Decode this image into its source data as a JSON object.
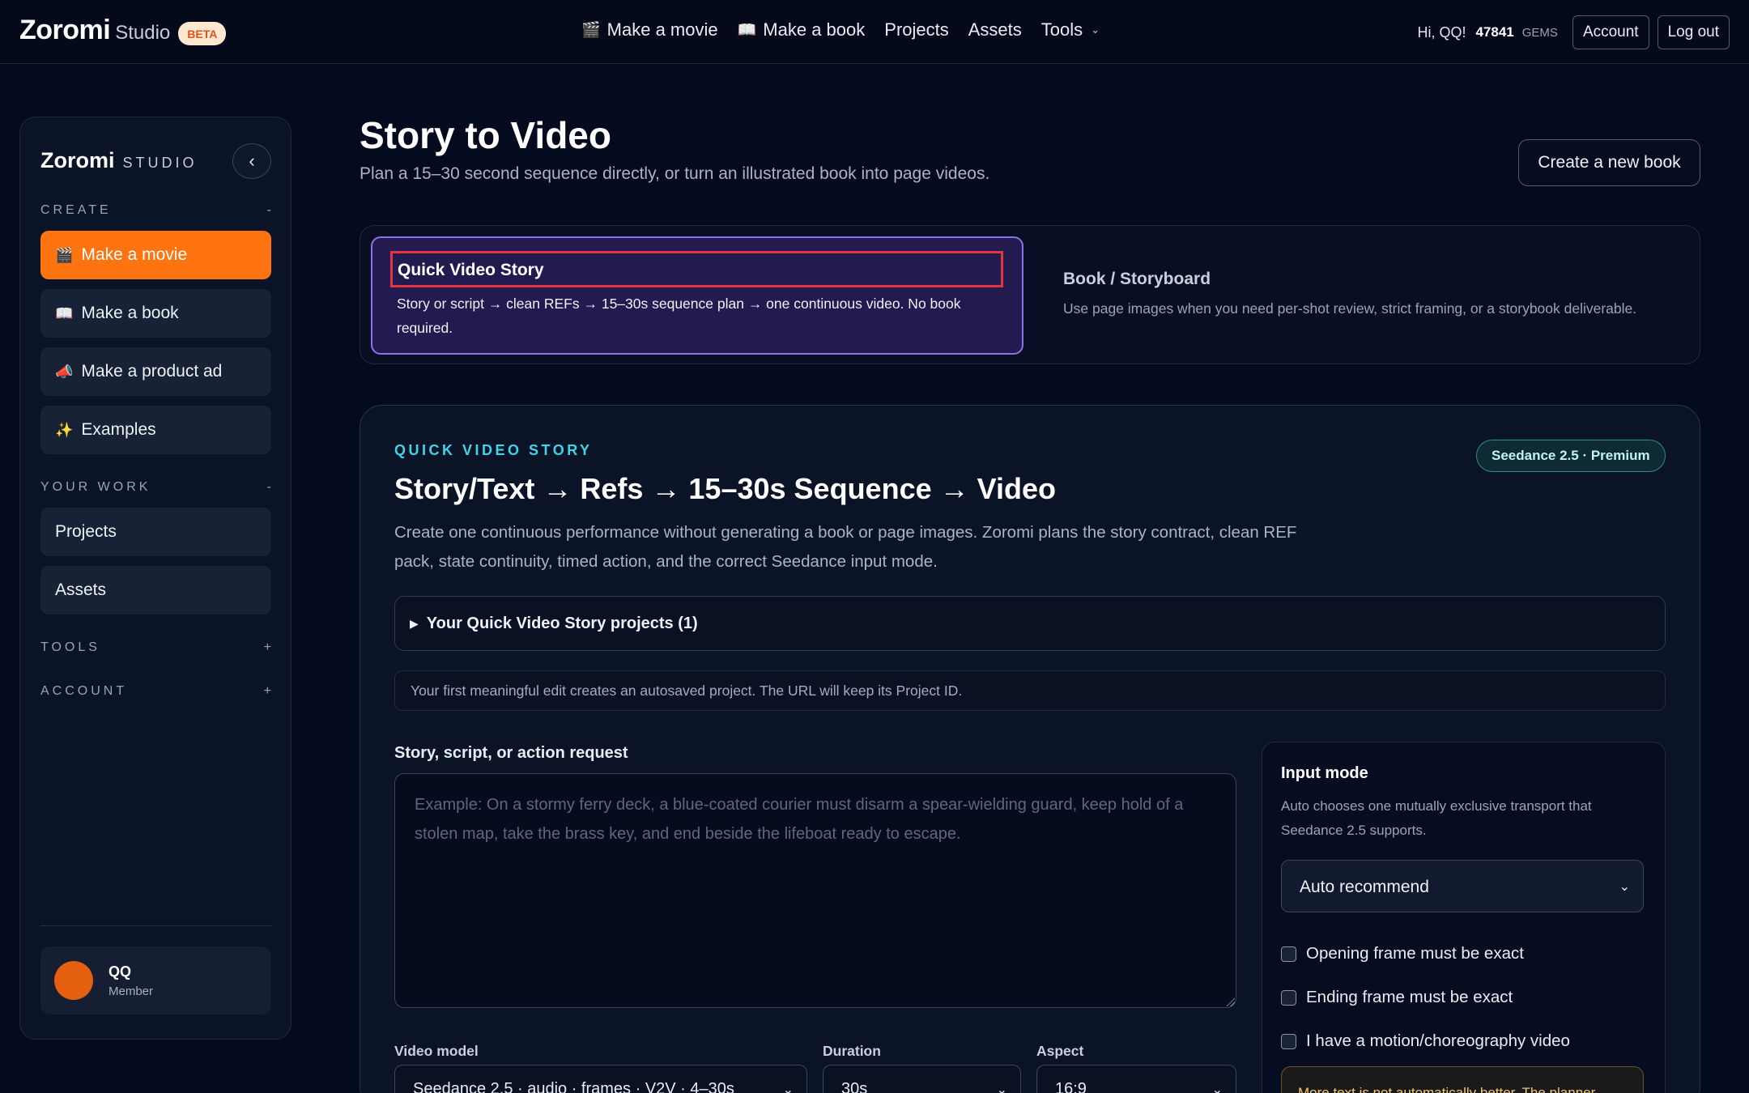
{
  "topbar": {
    "brand": "Zoromi",
    "brand_sub": "Studio",
    "badge": "BETA",
    "nav": [
      {
        "icon": "🎬",
        "label": "Make a movie"
      },
      {
        "icon": "📖",
        "label": "Make a book"
      },
      {
        "icon": "",
        "label": "Projects"
      },
      {
        "icon": "",
        "label": "Assets"
      },
      {
        "icon": "",
        "label": "Tools"
      }
    ],
    "tools_caret": "⌄",
    "greeting": "Hi, QQ!",
    "gems_count": "47841",
    "gems_label": "GEMS",
    "account_label": "Account",
    "logout_label": "Log out"
  },
  "sidebar": {
    "title": "Zoromi",
    "studio": "STUDIO",
    "collapse_icon": "‹",
    "create_label": "CREATE",
    "create_toggle": "-",
    "create_items": [
      {
        "icon": "🎬",
        "label": "Make a movie"
      },
      {
        "icon": "📖",
        "label": "Make a book"
      },
      {
        "icon": "📣",
        "label": "Make a product ad"
      },
      {
        "icon": "✨",
        "label": "Examples"
      }
    ],
    "work_label": "YOUR WORK",
    "work_toggle": "-",
    "work_items": [
      {
        "label": "Projects"
      },
      {
        "label": "Assets"
      }
    ],
    "tools_label": "TOOLS",
    "tools_toggle": "+",
    "account_label": "ACCOUNT",
    "account_toggle": "+",
    "user_name": "QQ",
    "user_role": "Member"
  },
  "main": {
    "title": "Story to Video",
    "subtitle": "Plan a 15–30 second sequence directly, or turn an illustrated book into page videos.",
    "new_book_button": "Create a new book",
    "modes": {
      "active_title": "Quick Video Story",
      "active_desc": "Story or script → clean REFs → 15–30s sequence plan → one continuous video. No book required.",
      "alt_title": "Book / Storyboard",
      "alt_desc": "Use page images when you need per-shot review, strict framing, or a storybook deliverable."
    },
    "card": {
      "eyebrow": "QUICK VIDEO STORY",
      "model_pill": "Seedance 2.5 · Premium",
      "title": "Story/Text → Refs → 15–30s Sequence → Video",
      "desc": "Create one continuous performance without generating a book or page images. Zoromi plans the story contract, clean REF pack, state continuity, timed action, and the correct Seedance input mode.",
      "projects_toggle_icon": "▶",
      "projects_toggle": "Your Quick Video Story projects (1)",
      "autosave_note": "Your first meaningful edit creates an autosaved project. The URL will keep its Project ID.",
      "story_label": "Story, script, or action request",
      "story_placeholder": "Example: On a stormy ferry deck, a blue-coated courier must disarm a spear-wielding guard, keep hold of a stolen map, take the brass key, and end beside the lifeboat ready to escape.",
      "story_value": "",
      "video_model_label": "Video model",
      "video_model_value": "Seedance 2.5 · audio · frames · V2V · 4–30s",
      "duration_label": "Duration",
      "duration_value": "30s",
      "aspect_label": "Aspect",
      "aspect_value": "16:9",
      "select_caret": "⌄"
    },
    "input_mode": {
      "title": "Input mode",
      "desc": "Auto chooses one mutually exclusive transport that Seedance 2.5 supports.",
      "selected": "Auto recommend",
      "checkboxes": [
        {
          "label": "Opening frame must be exact",
          "checked": false
        },
        {
          "label": "Ending frame must be exact",
          "checked": false
        },
        {
          "label": "I have a motion/choreography video",
          "checked": false
        }
      ],
      "warning": "More text is not automatically better. The planner"
    }
  }
}
